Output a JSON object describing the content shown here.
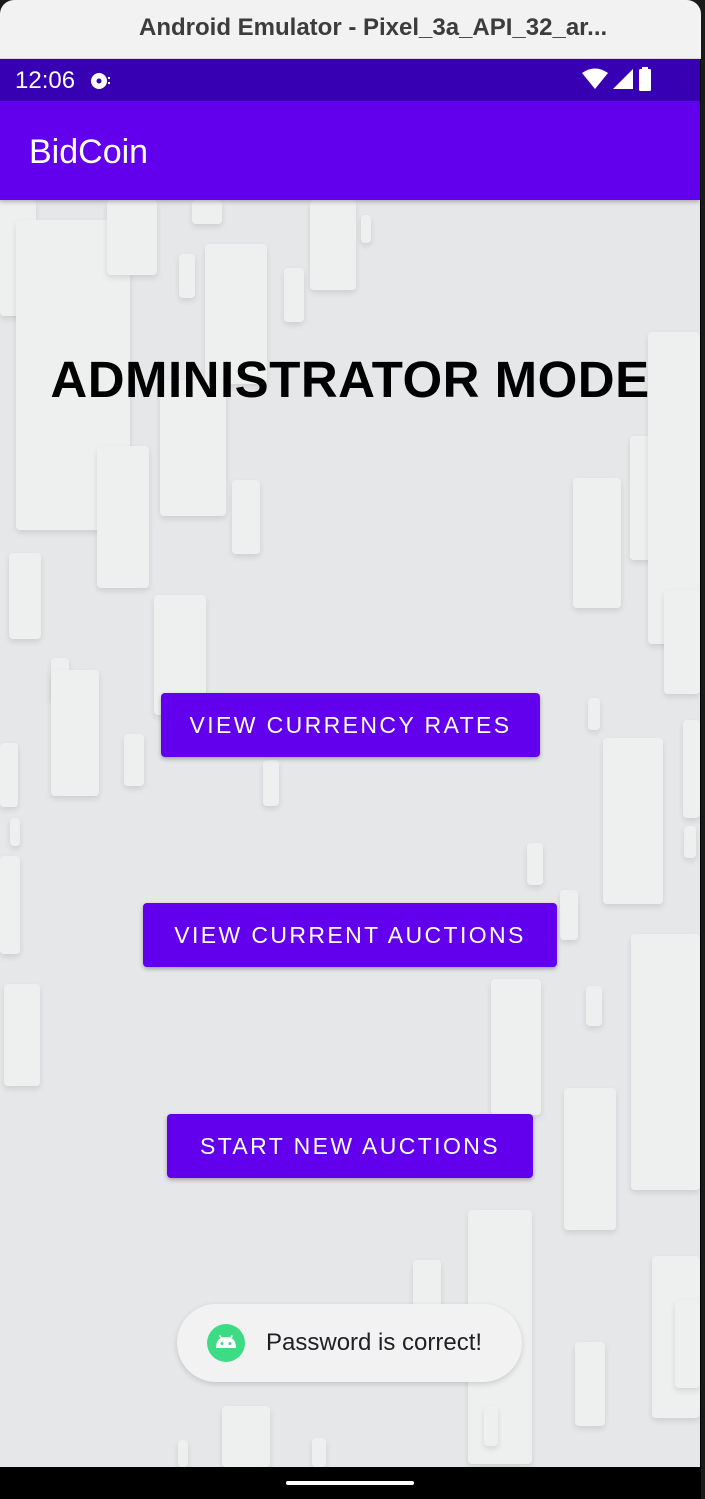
{
  "window": {
    "title": "Android Emulator - Pixel_3a_API_32_ar..."
  },
  "status_bar": {
    "time": "12:06",
    "icons": [
      "disk-icon",
      "wifi-icon",
      "signal-icon",
      "battery-icon"
    ]
  },
  "app_bar": {
    "title": "BidCoin"
  },
  "main": {
    "heading": "ADMINISTRATOR MODE",
    "buttons": {
      "view_rates": "VIEW CURRENCY RATES",
      "view_auctions": "VIEW CURRENT AUCTIONS",
      "start_auctions": "START NEW AUCTIONS"
    }
  },
  "toast": {
    "message": "Password is correct!",
    "icon": "android-icon"
  },
  "colors": {
    "primary": "#6200ee",
    "primary_dark": "#3700b3",
    "background": "#e6e7e8",
    "text": "#000000",
    "toast_icon": "#3ddc84"
  }
}
